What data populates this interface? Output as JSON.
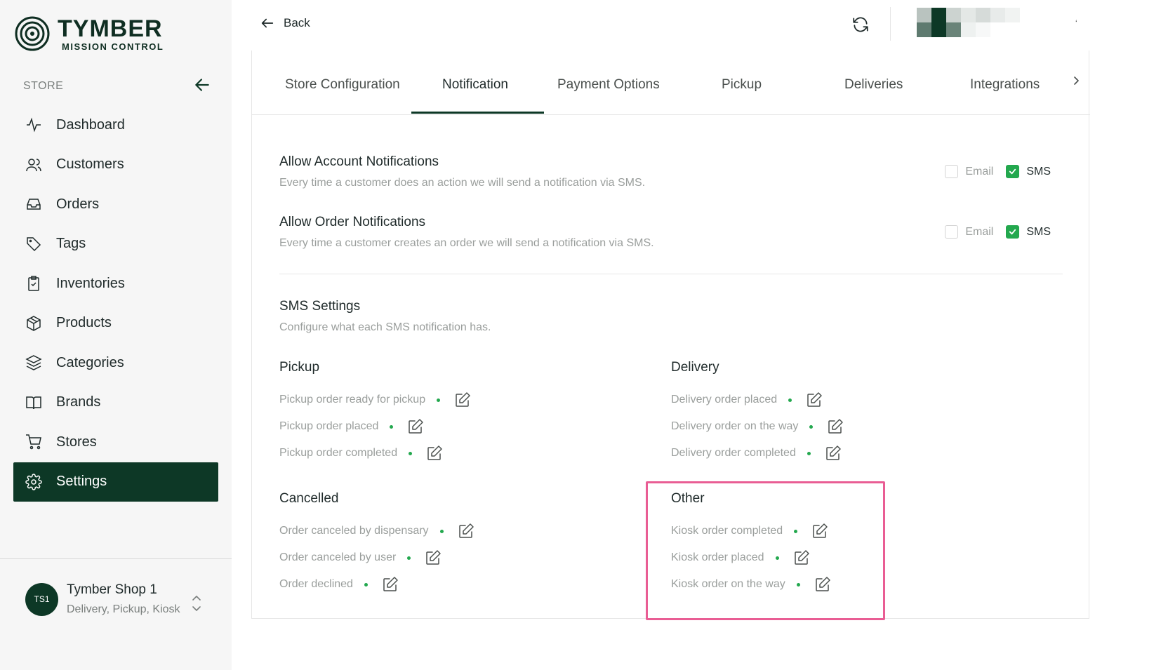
{
  "logo": {
    "brand": "TYMBER",
    "subtitle": "MISSION CONTROL"
  },
  "sidebar": {
    "section_label": "STORE",
    "items": [
      {
        "label": "Dashboard",
        "icon": "activity-icon"
      },
      {
        "label": "Customers",
        "icon": "users-icon"
      },
      {
        "label": "Orders",
        "icon": "inbox-icon"
      },
      {
        "label": "Tags",
        "icon": "tag-icon"
      },
      {
        "label": "Inventories",
        "icon": "clipboard-check-icon"
      },
      {
        "label": "Products",
        "icon": "package-icon"
      },
      {
        "label": "Categories",
        "icon": "layers-icon"
      },
      {
        "label": "Brands",
        "icon": "book-open-icon"
      },
      {
        "label": "Stores",
        "icon": "shopping-cart-icon"
      },
      {
        "label": "Settings",
        "icon": "gear-icon",
        "active": true
      }
    ],
    "shop": {
      "initials": "TS1",
      "name": "Tymber Shop 1",
      "types": "Delivery, Pickup, Kiosk"
    }
  },
  "topbar": {
    "back_label": "Back"
  },
  "tabs": [
    {
      "label": "Store Configuration"
    },
    {
      "label": "Notification",
      "active": true
    },
    {
      "label": "Payment Options"
    },
    {
      "label": "Pickup"
    },
    {
      "label": "Deliveries"
    },
    {
      "label": "Integrations"
    }
  ],
  "notifications": {
    "account": {
      "title": "Allow Account Notifications",
      "description": "Every time a customer does an action we will send a notification via SMS.",
      "email_label": "Email",
      "email_checked": false,
      "sms_label": "SMS",
      "sms_checked": true
    },
    "order": {
      "title": "Allow Order Notifications",
      "description": "Every time a customer creates an order we will send a notification via SMS.",
      "email_label": "Email",
      "email_checked": false,
      "sms_label": "SMS",
      "sms_checked": true
    }
  },
  "sms_settings": {
    "title": "SMS Settings",
    "description": "Configure what each SMS notification has.",
    "groups": {
      "pickup": {
        "title": "Pickup",
        "items": [
          "Pickup order ready for pickup",
          "Pickup order placed",
          "Pickup order completed"
        ]
      },
      "delivery": {
        "title": "Delivery",
        "items": [
          "Delivery order placed",
          "Delivery order on the way",
          "Delivery order completed"
        ]
      },
      "cancelled": {
        "title": "Cancelled",
        "items": [
          "Order canceled by dispensary",
          "Order canceled by user",
          "Order declined"
        ]
      },
      "other": {
        "title": "Other",
        "items": [
          "Kiosk order completed",
          "Kiosk order placed",
          "Kiosk order on the way"
        ]
      }
    }
  },
  "colors": {
    "brand_dark": "#0d3826",
    "status_green": "#23a84e",
    "highlight": "#e95d94"
  }
}
